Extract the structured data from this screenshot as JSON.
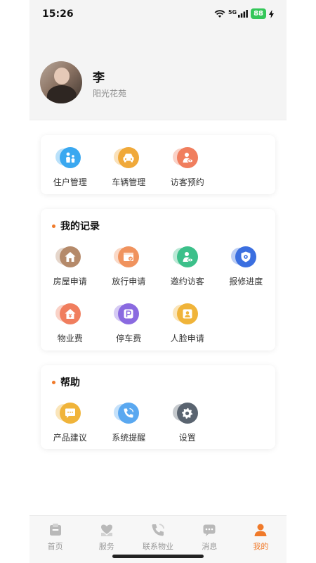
{
  "status_bar": {
    "time": "15:26",
    "network": "5G",
    "battery": "88"
  },
  "profile": {
    "name": "李",
    "community": "阳光花苑"
  },
  "quick_actions": [
    {
      "label": "住户管理",
      "icon": "residents-icon",
      "color": "#3aa8f0"
    },
    {
      "label": "车辆管理",
      "icon": "car-icon",
      "color": "#f0a93a"
    },
    {
      "label": "访客预约",
      "icon": "visitor-icon",
      "color": "#f07e5e"
    }
  ],
  "records": {
    "title": "我的记录",
    "items": [
      {
        "label": "房屋申请",
        "icon": "house-icon",
        "color": "#b58a6a"
      },
      {
        "label": "放行申请",
        "icon": "release-icon",
        "color": "#f0935e"
      },
      {
        "label": "邀约访客",
        "icon": "invite-icon",
        "color": "#3cc08a"
      },
      {
        "label": "报修进度",
        "icon": "repair-shield-icon",
        "color": "#3b6fe0"
      },
      {
        "label": "物业费",
        "icon": "property-fee-icon",
        "color": "#f07e5e"
      },
      {
        "label": "停车费",
        "icon": "parking-icon",
        "color": "#8a6ae0"
      },
      {
        "label": "人脸申请",
        "icon": "face-icon",
        "color": "#f0b43a"
      }
    ]
  },
  "help": {
    "title": "帮助",
    "items": [
      {
        "label": "产品建议",
        "icon": "feedback-icon",
        "color": "#f0b43a"
      },
      {
        "label": "系统提醒",
        "icon": "phone-icon",
        "color": "#5aa8f0"
      },
      {
        "label": "设置",
        "icon": "gear-icon",
        "color": "#5a6470"
      }
    ]
  },
  "tabbar": {
    "active": "我的",
    "tabs": [
      {
        "label": "首页",
        "icon": "home-tab-icon"
      },
      {
        "label": "服务",
        "icon": "service-tab-icon"
      },
      {
        "label": "联系物业",
        "icon": "contact-tab-icon"
      },
      {
        "label": "消息",
        "icon": "message-tab-icon"
      },
      {
        "label": "我的",
        "icon": "profile-tab-icon"
      }
    ]
  },
  "colors": {
    "accent": "#f07a2a",
    "tab_inactive": "#999999",
    "header_bg": "#f4f4f4"
  }
}
